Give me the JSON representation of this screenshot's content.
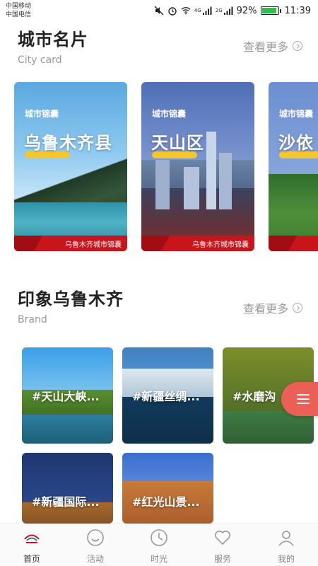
{
  "status_bar": {
    "carrier_1": "中国移动",
    "carrier_2": "中国电信",
    "network_1": "4G",
    "network_2": "2G",
    "battery": "92%",
    "battery_level": 0.92,
    "time": "11:39",
    "icons": [
      "mute-icon",
      "alarm-icon",
      "wifi-icon",
      "signal-icon",
      "signal-icon",
      "battery-icon"
    ]
  },
  "city_section": {
    "title": "城市名片",
    "subtitle": "City card",
    "more_label": "查看更多",
    "cards": [
      {
        "small_label": "城市锦囊",
        "name": "乌鲁木齐县",
        "ribbon": "乌鲁木齐城市锦囊"
      },
      {
        "small_label": "城市锦囊",
        "name": "天山区",
        "ribbon": "乌鲁木齐城市锦囊"
      },
      {
        "small_label": "城市锦囊",
        "name": "沙依",
        "ribbon": ""
      }
    ]
  },
  "brand_section": {
    "title": "印象乌鲁木齐",
    "subtitle": "Brand",
    "more_label": "查看更多",
    "tiles": [
      {
        "label": "#天山大峡..."
      },
      {
        "label": "#新疆丝绸..."
      },
      {
        "label": "#水磨沟"
      },
      {
        "label": "#新疆国际..."
      },
      {
        "label": "#红光山景..."
      }
    ]
  },
  "fab": {
    "icon": "menu-icon",
    "color": "#ec5f56"
  },
  "tab_bar": {
    "tabs": [
      {
        "label": "首页",
        "icon": "home-logo-icon",
        "active": true
      },
      {
        "label": "活动",
        "icon": "smile-icon",
        "active": false
      },
      {
        "label": "时光",
        "icon": "clock-icon",
        "active": false
      },
      {
        "label": "服务",
        "icon": "heart-icon",
        "active": false
      },
      {
        "label": "我的",
        "icon": "user-icon",
        "active": false
      }
    ]
  },
  "colors": {
    "accent_red": "#c9141c",
    "highlight_yellow": "#f3c72f",
    "muted_text": "#999999"
  }
}
